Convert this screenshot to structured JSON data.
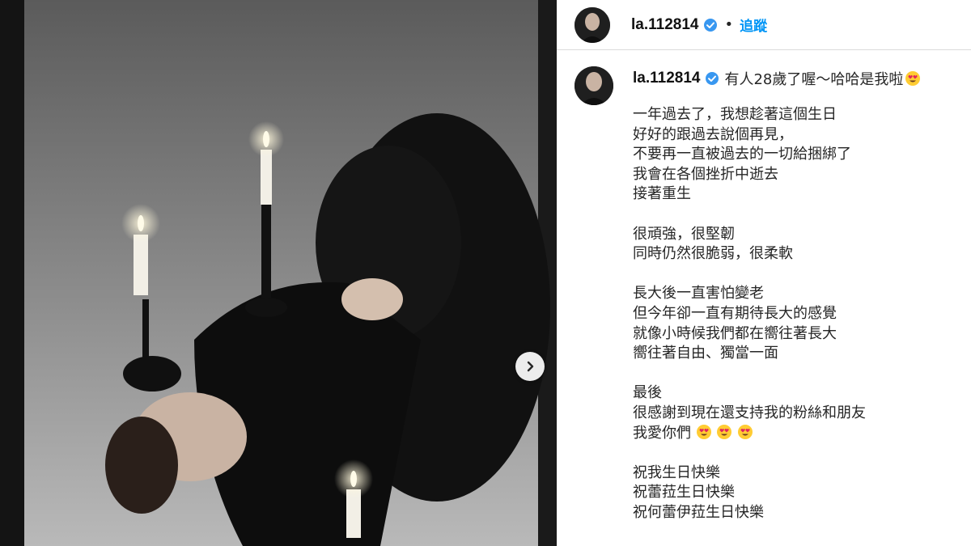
{
  "post": {
    "image_alt": "candle-lit portrait"
  },
  "header": {
    "username": "la.112814",
    "separator": "•",
    "follow_label": "追蹤"
  },
  "caption": {
    "username": "la.112814",
    "first_line": "有人28歲了喔～哈哈是我啦",
    "paragraphs": [
      [
        "一年過去了，我想趁著這個生日",
        "好好的跟過去說個再見，",
        "不要再一直被過去的一切給捆綁了",
        "我會在各個挫折中逝去",
        "接著重生"
      ],
      [
        "很頑強，很堅韌",
        "同時仍然很脆弱，很柔軟"
      ],
      [
        "長大後一直害怕變老",
        "但今年卻一直有期待長大的感覺",
        "就像小時候我們都在嚮往著長大",
        "嚮往著自由、獨當一面"
      ],
      [
        "最後",
        "很感謝到現在還支持我的粉絲和朋友",
        "我愛你們"
      ],
      [
        "祝我生日快樂",
        "祝蕾菈生日快樂",
        "祝何蕾伊菈生日快樂"
      ]
    ]
  },
  "icons": {
    "verified": "verified-badge-icon",
    "next": "chevron-right-icon",
    "emoji": "heart-eyes-emoji-icon"
  },
  "colors": {
    "link": "#0095f6",
    "verified": "#3897f0",
    "text": "#262626"
  }
}
